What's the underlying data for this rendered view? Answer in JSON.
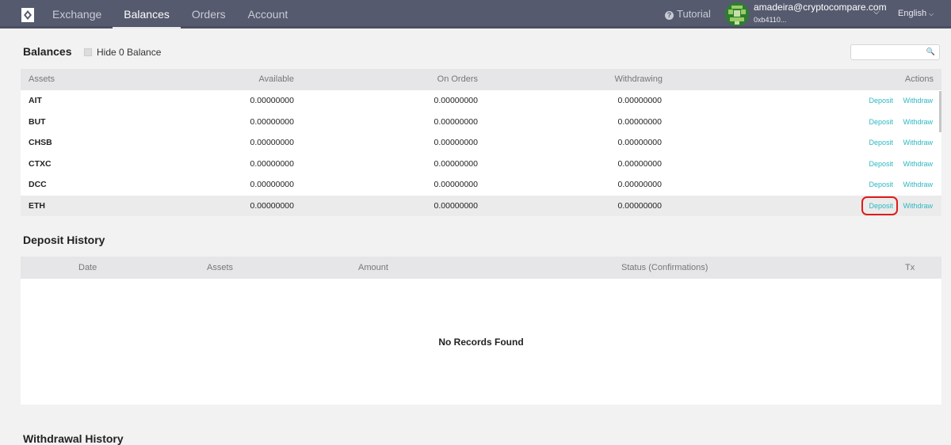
{
  "header": {
    "nav": [
      "Exchange",
      "Balances",
      "Orders",
      "Account"
    ],
    "active_nav": "Balances",
    "tutorial_label": "Tutorial",
    "user_email": "amadeira@cryptocompare.com",
    "user_address": "0xb4110...",
    "language": "English"
  },
  "balances": {
    "title": "Balances",
    "hide_zero_label": "Hide 0 Balance",
    "search_placeholder": "",
    "columns": [
      "Assets",
      "Available",
      "On Orders",
      "Withdrawing",
      "Actions"
    ],
    "rows": [
      {
        "asset": "AIT",
        "available": "0.00000000",
        "on_orders": "0.00000000",
        "withdrawing": "0.00000000",
        "deposit": "Deposit",
        "withdraw": "Withdraw"
      },
      {
        "asset": "BUT",
        "available": "0.00000000",
        "on_orders": "0.00000000",
        "withdrawing": "0.00000000",
        "deposit": "Deposit",
        "withdraw": "Withdraw"
      },
      {
        "asset": "CHSB",
        "available": "0.00000000",
        "on_orders": "0.00000000",
        "withdrawing": "0.00000000",
        "deposit": "Deposit",
        "withdraw": "Withdraw"
      },
      {
        "asset": "CTXC",
        "available": "0.00000000",
        "on_orders": "0.00000000",
        "withdrawing": "0.00000000",
        "deposit": "Deposit",
        "withdraw": "Withdraw"
      },
      {
        "asset": "DCC",
        "available": "0.00000000",
        "on_orders": "0.00000000",
        "withdrawing": "0.00000000",
        "deposit": "Deposit",
        "withdraw": "Withdraw"
      },
      {
        "asset": "ETH",
        "available": "0.00000000",
        "on_orders": "0.00000000",
        "withdrawing": "0.00000000",
        "deposit": "Deposit",
        "withdraw": "Withdraw"
      }
    ]
  },
  "deposit_history": {
    "title": "Deposit History",
    "columns": [
      "Date",
      "Assets",
      "Amount",
      "Status (Confirmations)",
      "Tx"
    ],
    "empty_text": "No Records Found"
  },
  "withdrawal_history": {
    "title": "Withdrawal History"
  },
  "colors": {
    "topbar": "#555a6e",
    "link": "#2bb8c2",
    "highlight": "#e01b1b"
  }
}
